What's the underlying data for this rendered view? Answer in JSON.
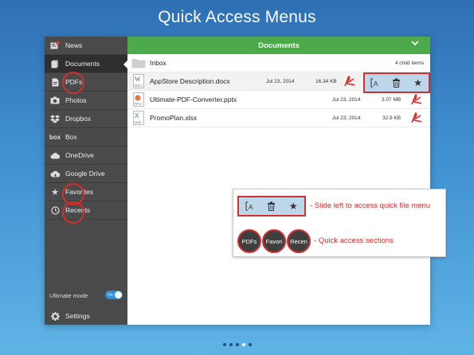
{
  "headline": "Quick Access Menus",
  "sidebar": {
    "items": [
      {
        "label": "News",
        "icon": "news-icon",
        "badge": "10"
      },
      {
        "label": "Documents",
        "icon": "documents-icon"
      },
      {
        "label": "PDFs",
        "icon": "pdf-file-icon"
      },
      {
        "label": "Photos",
        "icon": "camera-icon"
      },
      {
        "label": "Dropbox",
        "icon": "dropbox-icon"
      },
      {
        "label": "Box",
        "icon": "box-logo-icon",
        "icon_text": "box"
      },
      {
        "label": "OneDrive",
        "icon": "onedrive-cloud-icon"
      },
      {
        "label": "Google Drive",
        "icon": "google-drive-icon"
      },
      {
        "label": "Favorites",
        "icon": "star-icon"
      },
      {
        "label": "Recents",
        "icon": "clock-icon"
      }
    ],
    "ultimate_mode_label": "Ultimate mode",
    "ultimate_toggle_text": "On",
    "settings_label": "Settings"
  },
  "main": {
    "title": "Documents",
    "inbox": {
      "name": "Inbox",
      "count": "4 child items"
    },
    "files": [
      {
        "name": "AppStore Description.docx",
        "date": "Jul 23, 2014",
        "size": "16.34 KB",
        "type_label": "DOCX",
        "type_letter": "W"
      },
      {
        "name": "Ultimate-PDF-Converter.pptx",
        "date": "Jul 23, 2014",
        "size": "3.07 MB",
        "type_label": "PPTX",
        "type_letter": "P"
      },
      {
        "name": "PromoPlan.xlsx",
        "date": "Jul 23, 2014",
        "size": "32.9 KB",
        "type_label": "XLSX",
        "type_letter": "X"
      }
    ]
  },
  "callout": {
    "slide_text": "- Slide left to access quick file menu",
    "sections_text": "- Quick access sections",
    "circles": [
      "PDFs",
      "Favori",
      "Recen"
    ]
  },
  "colors": {
    "green": "#4caa4a",
    "red": "#d32f2f",
    "menu_blue": "#bcd6ea",
    "sidebar": "#4a4a4a"
  }
}
